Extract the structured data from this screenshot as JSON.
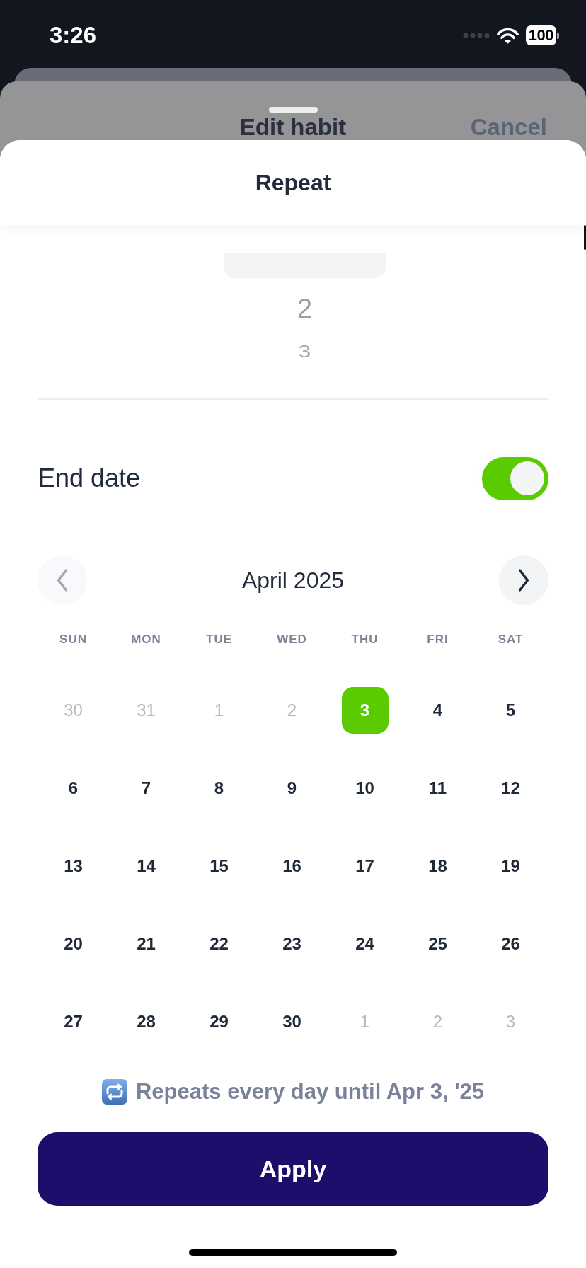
{
  "status_bar": {
    "time": "3:26",
    "battery": "100"
  },
  "background_sheet": {
    "title": "Edit habit",
    "cancel": "Cancel"
  },
  "sheet": {
    "title": "Repeat"
  },
  "interval_picker": {
    "options": [
      {
        "label": "2",
        "selected": false
      },
      {
        "label": "3",
        "selected": false
      }
    ]
  },
  "end_date": {
    "label": "End date",
    "on": true
  },
  "calendar": {
    "month": "April 2025",
    "previous": {
      "disabled": true
    },
    "next": {
      "disabled": false
    },
    "weekdays": [
      "SUN",
      "MON",
      "TUE",
      "WED",
      "THU",
      "FRI",
      "SAT"
    ],
    "weeks": [
      [
        {
          "day": "30",
          "outside_month": true,
          "selected": false
        },
        {
          "day": "31",
          "outside_month": true,
          "selected": false
        },
        {
          "day": "1",
          "outside_month": true,
          "selected": false
        },
        {
          "day": "2",
          "outside_month": true,
          "selected": false
        },
        {
          "day": "3",
          "outside_month": false,
          "selected": true
        },
        {
          "day": "4",
          "outside_month": false,
          "selected": false
        },
        {
          "day": "5",
          "outside_month": false,
          "selected": false
        }
      ],
      [
        {
          "day": "6",
          "outside_month": false,
          "selected": false
        },
        {
          "day": "7",
          "outside_month": false,
          "selected": false
        },
        {
          "day": "8",
          "outside_month": false,
          "selected": false
        },
        {
          "day": "9",
          "outside_month": false,
          "selected": false
        },
        {
          "day": "10",
          "outside_month": false,
          "selected": false
        },
        {
          "day": "11",
          "outside_month": false,
          "selected": false
        },
        {
          "day": "12",
          "outside_month": false,
          "selected": false
        }
      ],
      [
        {
          "day": "13",
          "outside_month": false,
          "selected": false
        },
        {
          "day": "14",
          "outside_month": false,
          "selected": false
        },
        {
          "day": "15",
          "outside_month": false,
          "selected": false
        },
        {
          "day": "16",
          "outside_month": false,
          "selected": false
        },
        {
          "day": "17",
          "outside_month": false,
          "selected": false
        },
        {
          "day": "18",
          "outside_month": false,
          "selected": false
        },
        {
          "day": "19",
          "outside_month": false,
          "selected": false
        }
      ],
      [
        {
          "day": "20",
          "outside_month": false,
          "selected": false
        },
        {
          "day": "21",
          "outside_month": false,
          "selected": false
        },
        {
          "day": "22",
          "outside_month": false,
          "selected": false
        },
        {
          "day": "23",
          "outside_month": false,
          "selected": false
        },
        {
          "day": "24",
          "outside_month": false,
          "selected": false
        },
        {
          "day": "25",
          "outside_month": false,
          "selected": false
        },
        {
          "day": "26",
          "outside_month": false,
          "selected": false
        }
      ],
      [
        {
          "day": "27",
          "outside_month": false,
          "selected": false
        },
        {
          "day": "28",
          "outside_month": false,
          "selected": false
        },
        {
          "day": "29",
          "outside_month": false,
          "selected": false
        },
        {
          "day": "30",
          "outside_month": false,
          "selected": false
        },
        {
          "day": "1",
          "outside_month": true,
          "selected": false
        },
        {
          "day": "2",
          "outside_month": true,
          "selected": false
        },
        {
          "day": "3",
          "outside_month": true,
          "selected": false
        }
      ]
    ]
  },
  "summary": "Repeats every day until Apr 3, '25",
  "apply_button": "Apply"
}
